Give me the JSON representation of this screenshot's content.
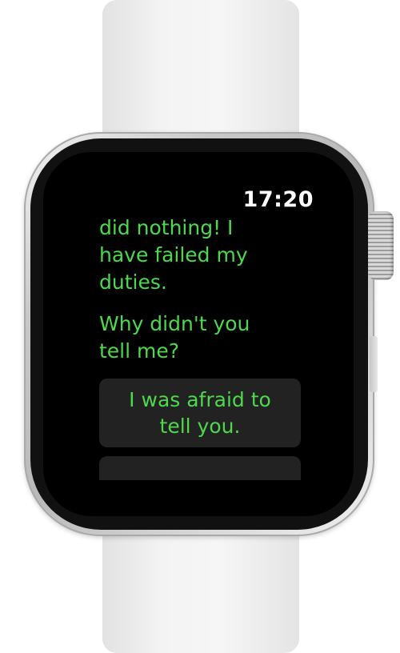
{
  "status": {
    "time": "17:20"
  },
  "conversation": {
    "messages": [
      {
        "text": "did nothing! I\nhave failed my\nduties."
      },
      {
        "text": "Why didn't you\ntell me?"
      }
    ],
    "replies": [
      {
        "label": "I was afraid to\ntell you."
      },
      {
        "label": ""
      }
    ]
  },
  "colors": {
    "message_text": "#4cd94c",
    "reply_background": "#222222",
    "screen_background": "#000000",
    "time_text": "#ffffff"
  }
}
